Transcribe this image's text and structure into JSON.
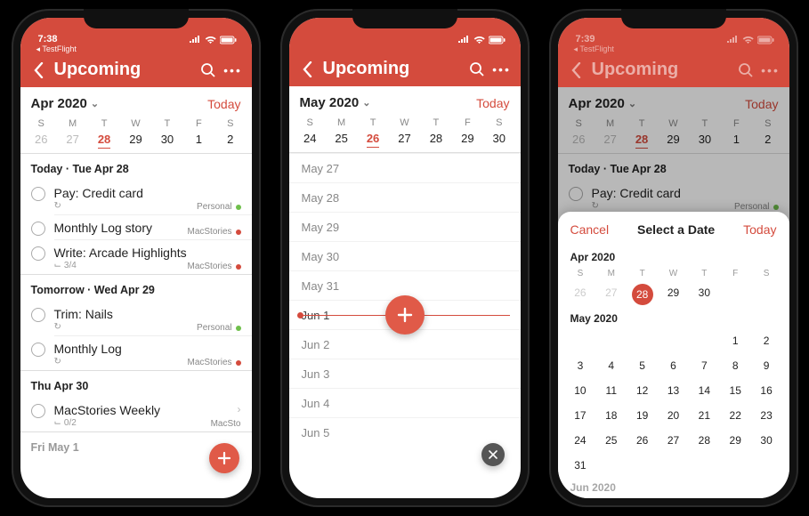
{
  "status": {
    "time1": "7:38",
    "time3": "7:39",
    "back": "TestFlight"
  },
  "nav": {
    "title": "Upcoming"
  },
  "phone1": {
    "month": "Apr 2020",
    "today": "Today",
    "weekdays": [
      "S",
      "M",
      "T",
      "W",
      "T",
      "F",
      "S"
    ],
    "days": [
      "26",
      "27",
      "28",
      "29",
      "30",
      "1",
      "2"
    ],
    "selected": "28",
    "sections": [
      {
        "header": "Today · Tue Apr 28",
        "tasks": [
          {
            "title": "Pay: Credit card",
            "recur": true,
            "tag": "Personal",
            "color": "green"
          },
          {
            "title": "Monthly Log story",
            "tag": "MacStories",
            "color": "red"
          },
          {
            "title": "Write: Arcade Highlights",
            "sub": "3/4",
            "tag": "MacStories",
            "color": "red"
          }
        ]
      },
      {
        "header": "Tomorrow · Wed Apr 29",
        "tasks": [
          {
            "title": "Trim: Nails",
            "recur": true,
            "tag": "Personal",
            "color": "green"
          },
          {
            "title": "Monthly Log",
            "recur": true,
            "tag": "MacStories",
            "color": "red"
          }
        ]
      },
      {
        "header": "Thu Apr 30",
        "tasks": [
          {
            "title": "MacStories Weekly",
            "sub": "0/2",
            "tag": "MacSto",
            "color": "red",
            "chev": true
          }
        ]
      },
      {
        "header": "Fri May 1",
        "tasks": []
      }
    ]
  },
  "phone2": {
    "month": "May 2020",
    "today": "Today",
    "weekdays": [
      "S",
      "M",
      "T",
      "W",
      "T",
      "F",
      "S"
    ],
    "days": [
      "24",
      "25",
      "26",
      "27",
      "28",
      "29",
      "30"
    ],
    "selected": "26",
    "rows": [
      "May 27",
      "May 28",
      "May 29",
      "May 30",
      "May 31",
      "Jun 1",
      "Jun 2",
      "Jun 3",
      "Jun 4",
      "Jun 5"
    ],
    "current": "Jun 1"
  },
  "phone3": {
    "month": "Apr 2020",
    "today": "Today",
    "weekdays": [
      "S",
      "M",
      "T",
      "W",
      "T",
      "F",
      "S"
    ],
    "days": [
      "26",
      "27",
      "28",
      "29",
      "30",
      "1",
      "2"
    ],
    "selected": "28",
    "section_header": "Today · Tue Apr 28",
    "task_title": "Pay: Credit card",
    "task_tag": "Personal",
    "sheet": {
      "cancel": "Cancel",
      "title": "Select a Date",
      "today": "Today",
      "m1": {
        "label": "Apr 2020",
        "wk": [
          "S",
          "M",
          "T",
          "W",
          "T",
          "F",
          "S"
        ],
        "rows": [
          [
            "26",
            "27",
            "28",
            "29",
            "30",
            "",
            ""
          ]
        ],
        "pick": "28",
        "muted": [
          "26",
          "27"
        ]
      },
      "m2": {
        "label": "May 2020",
        "rows": [
          [
            "",
            "",
            "",
            "",
            "",
            "1",
            "2"
          ],
          [
            "3",
            "4",
            "5",
            "6",
            "7",
            "8",
            "9"
          ],
          [
            "10",
            "11",
            "12",
            "13",
            "14",
            "15",
            "16"
          ],
          [
            "17",
            "18",
            "19",
            "20",
            "21",
            "22",
            "23"
          ],
          [
            "24",
            "25",
            "26",
            "27",
            "28",
            "29",
            "30"
          ],
          [
            "31",
            "",
            "",
            "",
            "",
            "",
            ""
          ]
        ]
      },
      "m3_label": "Jun 2020"
    }
  }
}
